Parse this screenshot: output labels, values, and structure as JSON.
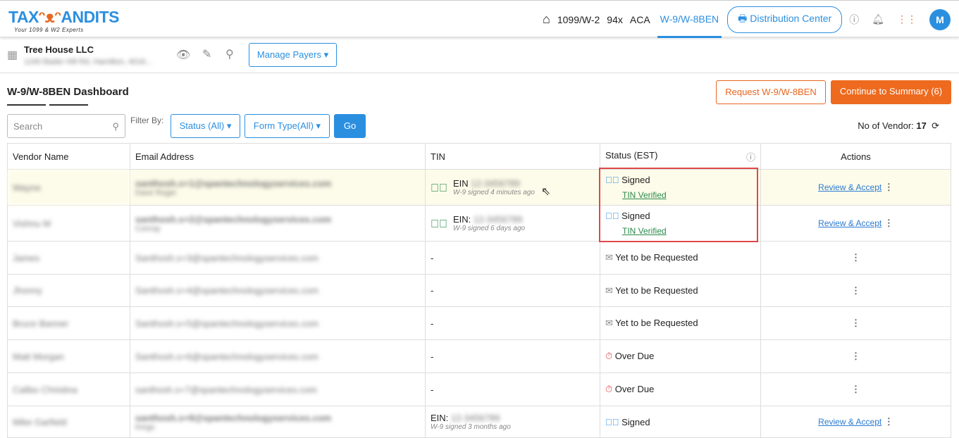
{
  "logo": {
    "text": "TAXBANDITS",
    "tagline": "Your 1099 & W2 Experts"
  },
  "nav": {
    "items": [
      "1099/W-2",
      "94x",
      "ACA",
      "W-9/W-8BEN"
    ],
    "active": "W-9/W-8BEN",
    "distribution": "Distribution Center",
    "avatar": "M"
  },
  "payer": {
    "name": "Tree House LLC",
    "manage": "Manage Payers"
  },
  "page": {
    "title": "W-9/W-8BEN Dashboard",
    "request": "Request W-9/W-8BEN",
    "continue": "Continue to Summary (6)"
  },
  "filter": {
    "search_placeholder": "Search",
    "label": "Filter By:",
    "status": "Status (All)",
    "form": "Form Type(All)",
    "go": "Go",
    "count_label": "No of Vendor:",
    "count": "17"
  },
  "table": {
    "headers": [
      "Vendor Name",
      "Email Address",
      "TIN",
      "Status (EST)",
      "Actions"
    ],
    "rows": [
      {
        "name": "Wayne",
        "email": "santhosh.s+1@spantechnologyservices.com",
        "email2": "Dave Roger",
        "tin": "EIN",
        "tin_sub": "W-9 signed 4 minutes ago",
        "status": "Signed",
        "verify": "TIN Verified",
        "action": "Review & Accept"
      },
      {
        "name": "Vishnu M",
        "email": "santhosh.s+2@spantechnologyservices.com",
        "email2": "Conray",
        "tin": "EIN:",
        "tin_sub": "W-9 signed 6 days ago",
        "status": "Signed",
        "verify": "TIN Verified",
        "action": "Review & Accept"
      },
      {
        "name": "James",
        "email": "Santhosh.s+3@spantechnologyservices.com",
        "tin": "-",
        "status": "Yet to be Requested"
      },
      {
        "name": "Jhonny",
        "email": "Santhosh.s+4@spantechnologyservices.com",
        "tin": "-",
        "status": "Yet to be Requested"
      },
      {
        "name": "Bruce Banner",
        "email": "Santhosh.s+5@spantechnologyservices.com",
        "tin": "-",
        "status": "Yet to be Requested"
      },
      {
        "name": "Matt Morgan",
        "email": "Santhosh.s+6@spantechnologyservices.com",
        "tin": "-",
        "status": "Over Due"
      },
      {
        "name": "Calibo Christina",
        "email": "santhosh.s+7@spantechnologyservices.com",
        "tin": "-",
        "status": "Over Due"
      },
      {
        "name": "Mike Garfield",
        "email": "santhosh.s+8@spantechnologyservices.com",
        "email2": "Kings",
        "tin": "EIN:",
        "tin_sub": "W-9 signed 3 months ago",
        "status": "Signed",
        "action": "Review & Accept"
      }
    ]
  }
}
